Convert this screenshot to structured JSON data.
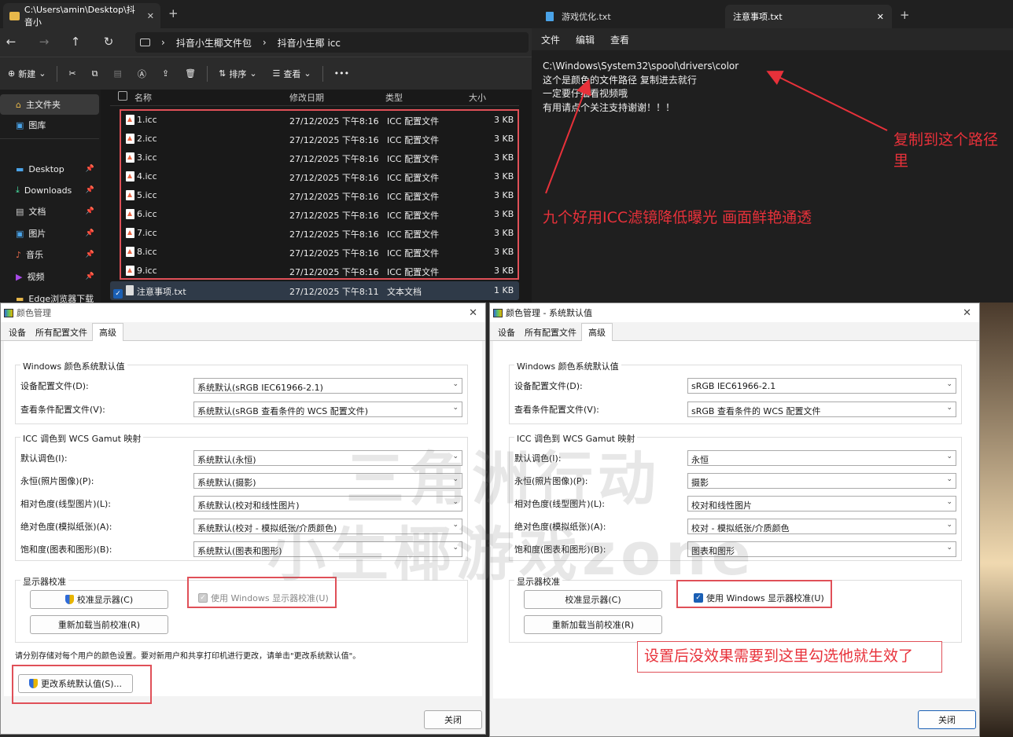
{
  "explorer": {
    "tab_title": "C:\\Users\\amin\\Desktop\\抖音小",
    "breadcrumbs": [
      "抖音小生椰文件包",
      "抖音小生椰 icc"
    ],
    "toolbar": {
      "new": "新建",
      "sort": "排序",
      "view": "查看"
    },
    "sidebar": [
      {
        "label": "主文件夹",
        "icon": "home-icon",
        "pin": false
      },
      {
        "label": "图库",
        "icon": "gallery-icon",
        "pin": false
      },
      {
        "label": "Desktop",
        "icon": "desktop-icon",
        "pin": true
      },
      {
        "label": "Downloads",
        "icon": "download-icon",
        "pin": true
      },
      {
        "label": "文档",
        "icon": "document-icon",
        "pin": true
      },
      {
        "label": "图片",
        "icon": "picture-icon",
        "pin": true
      },
      {
        "label": "音乐",
        "icon": "music-icon",
        "pin": true
      },
      {
        "label": "视频",
        "icon": "video-icon",
        "pin": true
      },
      {
        "label": "Edge浏览器下载",
        "icon": "folder-icon",
        "pin": false
      }
    ],
    "columns": {
      "name": "名称",
      "date": "修改日期",
      "type": "类型",
      "size": "大小"
    },
    "files": [
      {
        "name": "1.icc",
        "date": "27/12/2025 下午8:16",
        "type": "ICC 配置文件",
        "size": "3 KB"
      },
      {
        "name": "2.icc",
        "date": "27/12/2025 下午8:16",
        "type": "ICC 配置文件",
        "size": "3 KB"
      },
      {
        "name": "3.icc",
        "date": "27/12/2025 下午8:16",
        "type": "ICC 配置文件",
        "size": "3 KB"
      },
      {
        "name": "4.icc",
        "date": "27/12/2025 下午8:16",
        "type": "ICC 配置文件",
        "size": "3 KB"
      },
      {
        "name": "5.icc",
        "date": "27/12/2025 下午8:16",
        "type": "ICC 配置文件",
        "size": "3 KB"
      },
      {
        "name": "6.icc",
        "date": "27/12/2025 下午8:16",
        "type": "ICC 配置文件",
        "size": "3 KB"
      },
      {
        "name": "7.icc",
        "date": "27/12/2025 下午8:16",
        "type": "ICC 配置文件",
        "size": "3 KB"
      },
      {
        "name": "8.icc",
        "date": "27/12/2025 下午8:16",
        "type": "ICC 配置文件",
        "size": "3 KB"
      },
      {
        "name": "9.icc",
        "date": "27/12/2025 下午8:16",
        "type": "ICC 配置文件",
        "size": "3 KB"
      },
      {
        "name": "注意事项.txt",
        "date": "27/12/2025 下午8:11",
        "type": "文本文档",
        "size": "1 KB"
      }
    ]
  },
  "notepad": {
    "tabs": [
      "游戏优化.txt",
      "注意事项.txt"
    ],
    "menu": [
      "文件",
      "编辑",
      "查看"
    ],
    "lines": [
      "C:\\Windows\\System32\\spool\\drivers\\color",
      "这个是颜色的文件路径 复制进去就行",
      "一定要仔细看视频哦",
      "有用请点个关注支持谢谢！！！"
    ]
  },
  "annotations": {
    "copy_path": "复制到这个路径\n里",
    "nine_icc": "九个好用ICC滤镜降低曝光 画面鲜艳通透",
    "check_hint": "设置后没效果需要到这里勾选他就生效了"
  },
  "watermark": {
    "line1": "三角洲行动",
    "line2": "小生椰游戏zone"
  },
  "dialog_left": {
    "title": "颜色管理",
    "tabs": [
      "设备",
      "所有配置文件",
      "高级"
    ],
    "group_windows": "Windows 颜色系统默认值",
    "device_profile_label": "设备配置文件(D):",
    "device_profile_value": "系统默认(sRGB IEC61966-2.1)",
    "viewing_label": "查看条件配置文件(V):",
    "viewing_value": "系统默认(sRGB 查看条件的 WCS 配置文件)",
    "group_gamut": "ICC 调色到 WCS Gamut 映射",
    "gamut": [
      {
        "label": "默认调色(I):",
        "value": "系统默认(永恒)"
      },
      {
        "label": "永恒(照片图像)(P):",
        "value": "系统默认(摄影)"
      },
      {
        "label": "相对色度(线型图片)(L):",
        "value": "系统默认(校对和线性图片)"
      },
      {
        "label": "绝对色度(模拟纸张)(A):",
        "value": "系统默认(校对 - 模拟纸张/介质颜色)"
      },
      {
        "label": "饱和度(图表和图形)(B):",
        "value": "系统默认(图表和图形)"
      }
    ],
    "group_calib": "显示器校准",
    "calibrate_btn": "校准显示器(C)",
    "reload_btn": "重新加载当前校准(R)",
    "use_calib": "使用 Windows 显示器校准(U)",
    "note": "请分别存储对每个用户的颜色设置。要对新用户和共享打印机进行更改，请单击\"更改系统默认值\"。",
    "change_defaults_btn": "更改系统默认值(S)...",
    "close_btn": "关闭"
  },
  "dialog_right": {
    "title": "颜色管理 - 系统默认值",
    "tabs": [
      "设备",
      "所有配置文件",
      "高级"
    ],
    "group_windows": "Windows 颜色系统默认值",
    "device_profile_label": "设备配置文件(D):",
    "device_profile_value": "sRGB IEC61966-2.1",
    "viewing_label": "查看条件配置文件(V):",
    "viewing_value": "sRGB 查看条件的 WCS 配置文件",
    "group_gamut": "ICC 调色到 WCS Gamut 映射",
    "gamut": [
      {
        "label": "默认调色(I):",
        "value": "永恒"
      },
      {
        "label": "永恒(照片图像)(P):",
        "value": "摄影"
      },
      {
        "label": "相对色度(线型图片)(L):",
        "value": "校对和线性图片"
      },
      {
        "label": "绝对色度(模拟纸张)(A):",
        "value": "校对 - 模拟纸张/介质颜色"
      },
      {
        "label": "饱和度(图表和图形)(B):",
        "value": "图表和图形"
      }
    ],
    "group_calib": "显示器校准",
    "calibrate_btn": "校准显示器(C)",
    "reload_btn": "重新加载当前校准(R)",
    "use_calib": "使用 Windows 显示器校准(U)",
    "close_btn": "关闭"
  }
}
